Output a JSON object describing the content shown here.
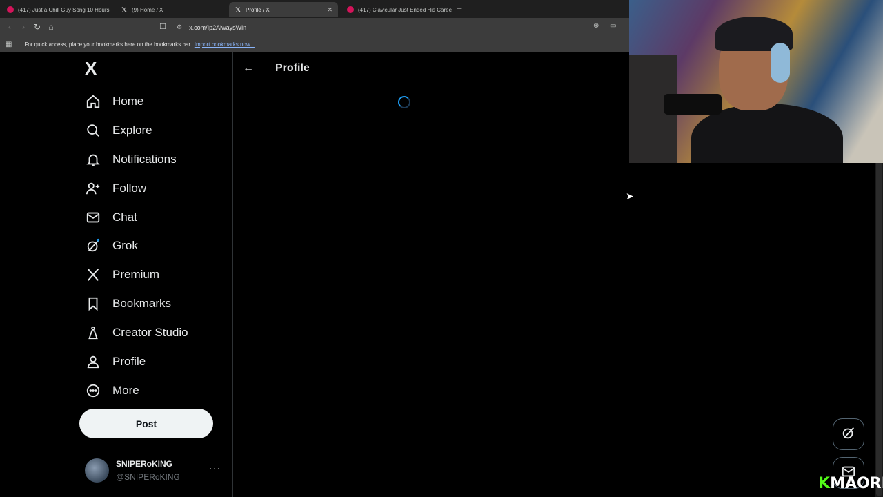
{
  "browser": {
    "tabs": [
      {
        "title": "(417) Just a Chill Guy Song 10 Hours",
        "favicon": "youtube-icon",
        "active": false
      },
      {
        "title": "(9) Home / X",
        "favicon": "x-icon",
        "active": false
      },
      {
        "title": "Profile / X",
        "favicon": "x-icon",
        "active": true
      },
      {
        "title": "(417) Clavicular Just Ended His Caree",
        "favicon": "youtube-icon",
        "active": false
      }
    ],
    "new_tab_symbol": "+",
    "url": "x.com/Ip2AlwaysWin",
    "bookmarks_hint": "For quick access, place your bookmarks here on the bookmarks bar.",
    "bookmarks_link": "Import bookmarks now..."
  },
  "sidebar": {
    "logo": "X",
    "items": [
      {
        "label": "Home",
        "icon": "home-icon"
      },
      {
        "label": "Explore",
        "icon": "search-icon"
      },
      {
        "label": "Notifications",
        "icon": "bell-icon"
      },
      {
        "label": "Follow",
        "icon": "add-person-icon"
      },
      {
        "label": "Chat",
        "icon": "envelope-icon"
      },
      {
        "label": "Grok",
        "icon": "grok-icon"
      },
      {
        "label": "Premium",
        "icon": "x-logo-icon"
      },
      {
        "label": "Bookmarks",
        "icon": "bookmark-icon"
      },
      {
        "label": "Creator Studio",
        "icon": "flask-icon"
      },
      {
        "label": "Profile",
        "icon": "person-icon"
      },
      {
        "label": "More",
        "icon": "more-circle-icon"
      }
    ],
    "post_label": "Post",
    "account": {
      "name": "SNIPERoKING",
      "handle": "@SNIPERoKING",
      "more": "···"
    }
  },
  "main": {
    "title": "Profile",
    "back_symbol": "←",
    "loading": true
  },
  "overlay": {
    "brand_k": "K",
    "brand_text": "MAORI"
  },
  "colors": {
    "background": "#000000",
    "text": "#e7e9ea",
    "accent": "#1d9bf0",
    "post_button": "#eff3f4",
    "border": "#2f3336"
  }
}
